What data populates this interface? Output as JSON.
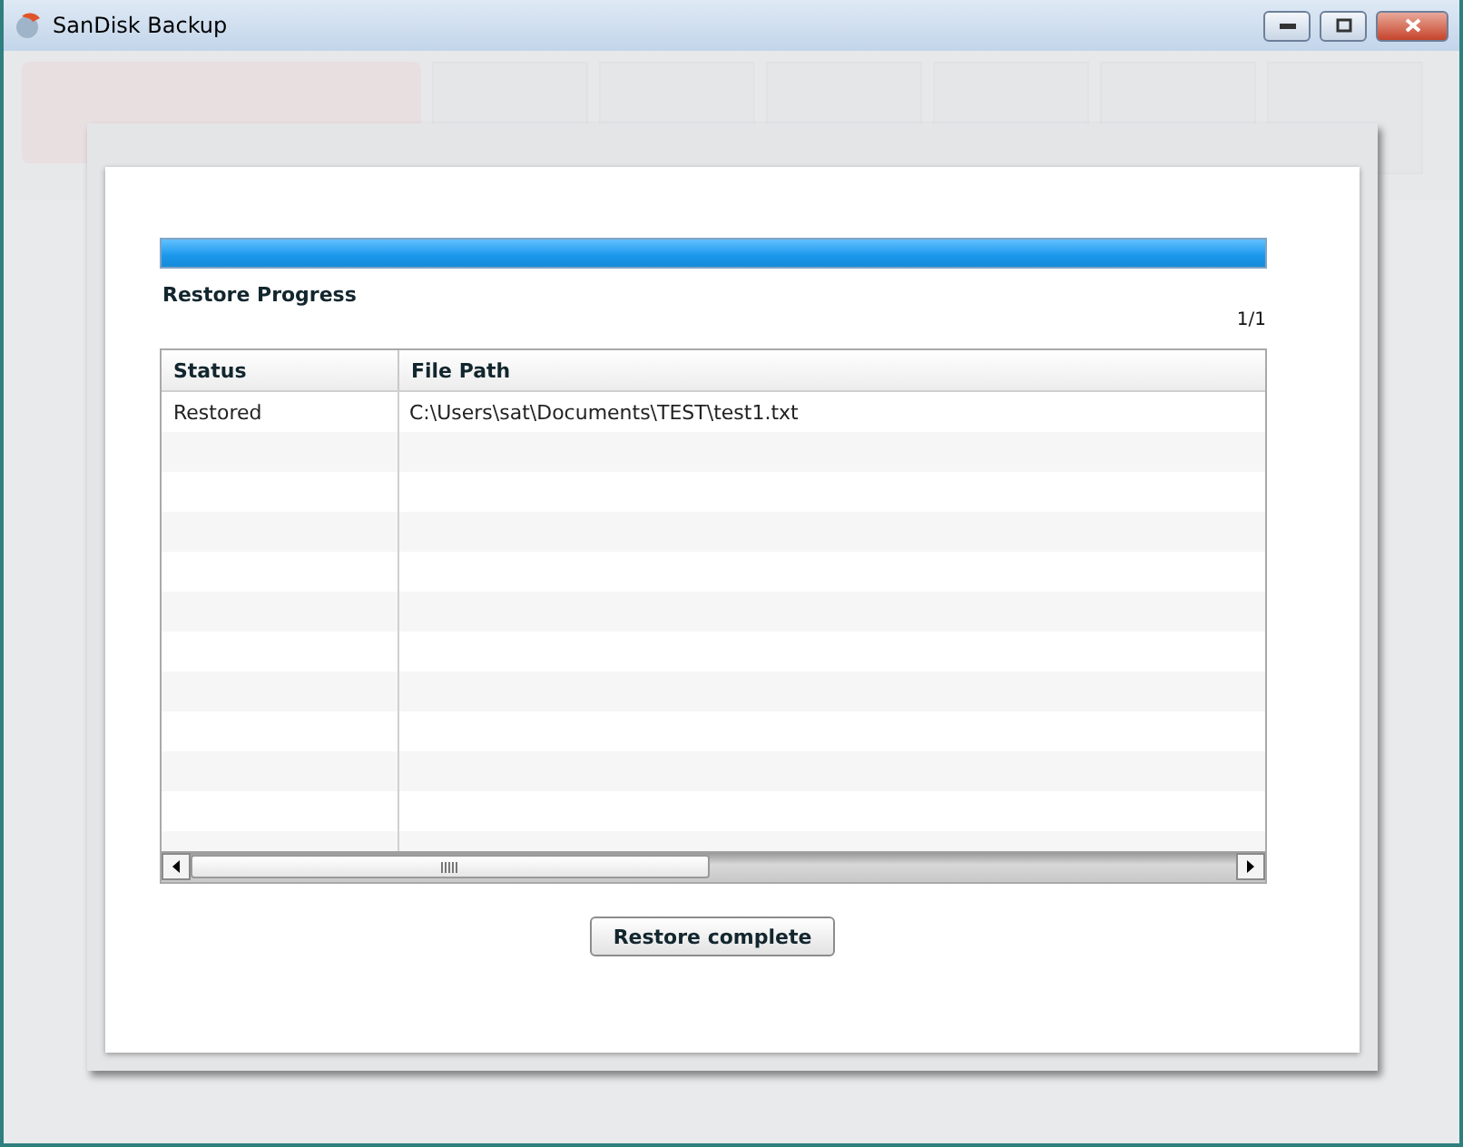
{
  "window": {
    "title": "SanDisk Backup"
  },
  "dialog": {
    "progress": {
      "level": 1
    },
    "title": "Restore Progress",
    "counter": "1/1",
    "table": {
      "columns": [
        "Status",
        "File Path"
      ],
      "rows": [
        {
          "status": "Restored",
          "file_path": "C:\\Users\\sat\\Documents\\TEST\\test1.txt"
        }
      ]
    },
    "button": "Restore complete"
  }
}
